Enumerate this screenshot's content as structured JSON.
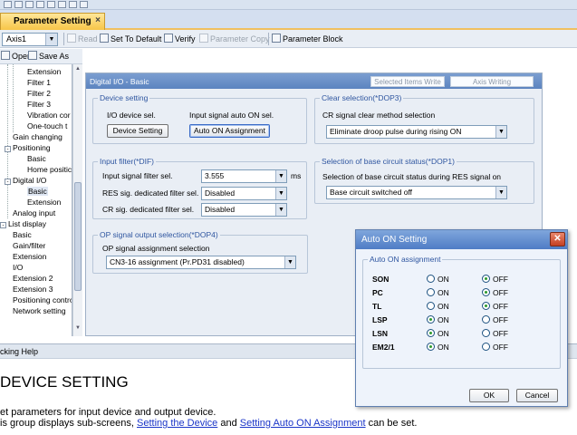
{
  "tab": {
    "title": "Parameter Setting",
    "close": "×"
  },
  "toolbar": {
    "axis": "Axis1",
    "read": "Read",
    "set_default": "Set To Default",
    "verify": "Verify",
    "parameter_copy": "Parameter Copy",
    "parameter_block": "Parameter Block",
    "open": "Open",
    "save_as": "Save As"
  },
  "tree": {
    "items": [
      {
        "label": "Extension"
      },
      {
        "label": "Filter 1"
      },
      {
        "label": "Filter 2"
      },
      {
        "label": "Filter 3"
      },
      {
        "label": "Vibration cor"
      },
      {
        "label": "One-touch t"
      },
      {
        "label": "Gain changing"
      },
      {
        "label": "Positioning"
      },
      {
        "label": "Basic"
      },
      {
        "label": "Home positic"
      },
      {
        "label": "Digital I/O"
      },
      {
        "label": "Basic"
      },
      {
        "label": "Extension"
      },
      {
        "label": "Analog input"
      },
      {
        "label": "List display"
      },
      {
        "label": "Basic"
      },
      {
        "label": "Gain/filter"
      },
      {
        "label": "Extension"
      },
      {
        "label": "I/O"
      },
      {
        "label": "Extension 2"
      },
      {
        "label": "Extension 3"
      },
      {
        "label": "Positioning contro"
      },
      {
        "label": "Network setting"
      }
    ]
  },
  "panel": {
    "title": "Digital I/O - Basic",
    "selected_items_write": "Selected Items Write",
    "axis_writing": "Axis Writing",
    "device_setting": {
      "title": "Device setting",
      "io_label": "I/O device sel.",
      "auto_on_label": "Input signal auto ON sel.",
      "device_button": "Device Setting",
      "auto_on_button": "Auto ON Assignment"
    },
    "clear_selection": {
      "title": "Clear selection(*DOP3)",
      "label": "CR signal clear method selection",
      "value": "Eliminate droop pulse during rising ON"
    },
    "input_filter": {
      "title": "Input filter(*DIF)",
      "filter_label": "Input signal filter sel.",
      "filter_value": "3.555",
      "unit": "ms",
      "res_label": "RES sig. dedicated filter sel.",
      "res_value": "Disabled",
      "cr_label": "CR sig. dedicated filter sel.",
      "cr_value": "Disabled"
    },
    "base_circuit": {
      "title": "Selection of base circuit status(*DOP1)",
      "label": "Selection of base circuit status during RES signal on",
      "value": "Base circuit switched off"
    },
    "op_signal": {
      "title": "OP signal output selection(*DOP4)",
      "label": "OP signal assignment selection",
      "value": "CN3-16 assignment (Pr.PD31 disabled)"
    }
  },
  "help": {
    "header": "cking Help",
    "title": "DEVICE SETTING",
    "p1": "et parameters for input device and output device.",
    "p2_prefix": "is group displays sub-screens, ",
    "link1": "Setting the Device",
    "p2_mid": " and ",
    "link2": "Setting Auto ON Assignment",
    "p2_suffix": " can be set."
  },
  "dialog": {
    "title": "Auto ON Setting",
    "group_title": "Auto ON assignment",
    "on_label": "ON",
    "off_label": "OFF",
    "signals": [
      {
        "name": "SON",
        "state": "OFF"
      },
      {
        "name": "PC",
        "state": "OFF"
      },
      {
        "name": "TL",
        "state": "OFF"
      },
      {
        "name": "LSP",
        "state": "ON"
      },
      {
        "name": "LSN",
        "state": "ON"
      },
      {
        "name": "EM2/1",
        "state": "ON"
      }
    ],
    "ok": "OK",
    "cancel": "Cancel"
  },
  "colors": {
    "tab_active": "#f7c548",
    "panel_header": "#5c84c0",
    "group_title": "#2f56a0",
    "link": "#1a35c8",
    "close_button": "#c43f23"
  }
}
